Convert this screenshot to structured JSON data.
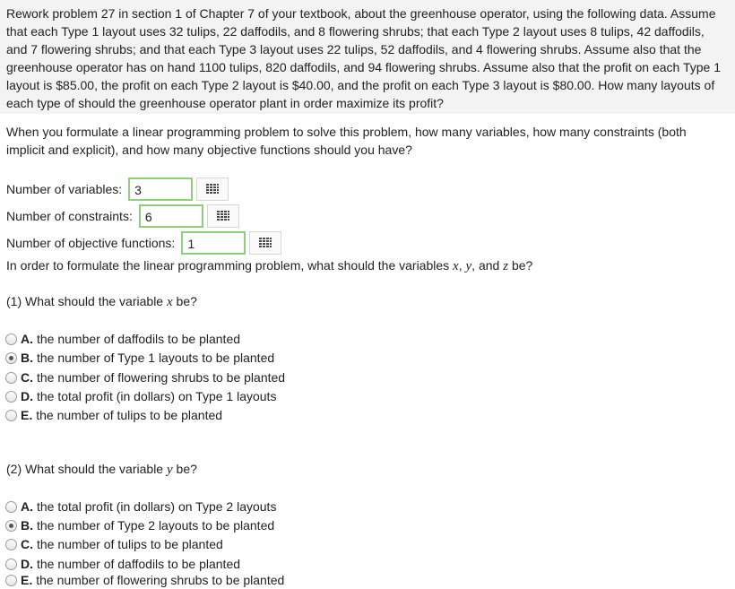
{
  "problem_text": "Rework problem 27 in section 1 of Chapter 7 of your textbook, about the greenhouse operator, using the following data. Assume that each Type 1 layout uses 32 tulips, 22 daffodils, and 8 flowering shrubs; that each Type 2 layout uses 8 tulips, 42 daffodils, and 7 flowering shrubs; and that each Type 3 layout uses 22 tulips, 52 daffodils, and 4 flowering shrubs. Assume also that the greenhouse operator has on hand 1100 tulips, 820 daffodils, and 94 flowering shrubs. Assume also that the profit on each Type 1 layout is $85.00, the profit on each Type 2 layout is $40.00, and the profit on each Type 3 layout is $80.00. How many layouts of each type of should the greenhouse operator plant in order maximize its profit?",
  "question_text": "When you formulate a linear programming problem to solve this problem, how many variables, how many constraints (both implicit and explicit), and how many objective functions should you have?",
  "fields": [
    {
      "label": "Number of variables:",
      "value": "3"
    },
    {
      "label": "Number of constraints:",
      "value": "6"
    },
    {
      "label": "Number of objective functions:",
      "value": "1"
    }
  ],
  "variables_prompt": {
    "prefix": "In order to formulate the linear programming problem, what should the variables",
    "x": "x",
    "sep1": ",",
    "y": "y",
    "sep2": ", and",
    "z": "z",
    "suffix": "be?"
  },
  "q1": {
    "prefix": "(1) What should the variable",
    "var": "x",
    "suffix": "be?",
    "options": [
      {
        "letter": "A.",
        "text": "the number of daffodils to be planted",
        "checked": false
      },
      {
        "letter": "B.",
        "text": "the number of Type 1 layouts to be planted",
        "checked": true
      },
      {
        "letter": "C.",
        "text": "the number of flowering shrubs to be planted",
        "checked": false
      },
      {
        "letter": "D.",
        "text": "the total profit (in dollars) on Type 1 layouts",
        "checked": false
      },
      {
        "letter": "E.",
        "text": "the number of tulips to be planted",
        "checked": false
      }
    ]
  },
  "q2": {
    "prefix": "(2) What should the variable",
    "var": "y",
    "suffix": "be?",
    "options": [
      {
        "letter": "A.",
        "text": "the total profit (in dollars) on Type 2 layouts",
        "checked": false
      },
      {
        "letter": "B.",
        "text": "the number of Type 2 layouts to be planted",
        "checked": true
      },
      {
        "letter": "C.",
        "text": "the number of tulips to be planted",
        "checked": false
      },
      {
        "letter": "D.",
        "text": "the number of daffodils to be planted",
        "checked": false
      },
      {
        "letter": "E.",
        "text": "the number of flowering shrubs to be planted",
        "checked": false
      }
    ]
  },
  "icons": {
    "field_button": "keypad-grid-icon",
    "radio": "radio-button-icon"
  }
}
